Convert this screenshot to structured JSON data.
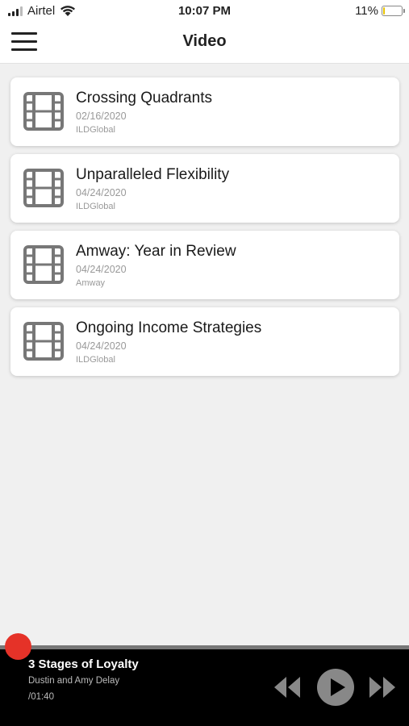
{
  "status_bar": {
    "carrier": "Airtel",
    "time": "10:07 PM",
    "battery_text": "11%",
    "battery_level": 0.11,
    "icons": [
      "signal-icon",
      "wifi-icon",
      "battery-icon"
    ]
  },
  "header": {
    "title": "Video",
    "menu_icon": "hamburger-menu-icon"
  },
  "videos": [
    {
      "title": "Crossing Quadrants",
      "date": "02/16/2020",
      "source": "ILDGlobal",
      "icon": "film-icon"
    },
    {
      "title": "Unparalleled Flexibility",
      "date": "04/24/2020",
      "source": "ILDGlobal",
      "icon": "film-icon"
    },
    {
      "title": "Amway: Year in Review",
      "date": "04/24/2020",
      "source": "Amway",
      "icon": "film-icon"
    },
    {
      "title": "Ongoing Income Strategies",
      "date": "04/24/2020",
      "source": "ILDGlobal",
      "icon": "film-icon"
    }
  ],
  "player": {
    "title": "3 Stages of Loyalty",
    "artist": "Dustin and Amy Delay",
    "time": "/01:40",
    "progress": 0.0,
    "icons": [
      "rewind-icon",
      "play-icon",
      "fast-forward-icon"
    ]
  },
  "colors": {
    "accent": "#e53228",
    "background": "#f0f0f0",
    "player_background": "#000000",
    "icon_gray": "#777777"
  }
}
